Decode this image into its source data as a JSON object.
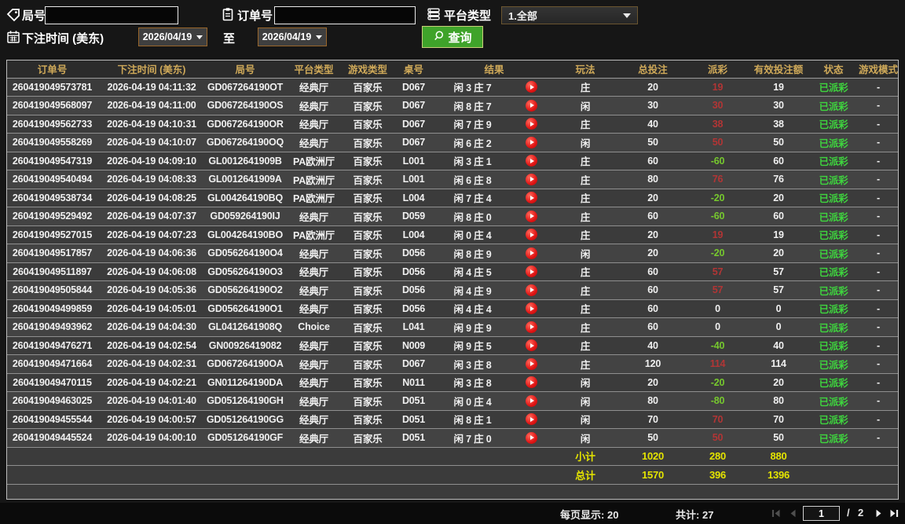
{
  "filters": {
    "round_label": "局号",
    "order_label": "订单号",
    "platform_label": "平台类型",
    "platform_value": "1.全部",
    "bet_time_label": "下注时间 (美东)",
    "date_from": "2026/04/19",
    "date_to": "2026/04/19",
    "to_label": "至",
    "search_label": "查询"
  },
  "icons": {
    "round": "tag-icon",
    "order": "clipboard-icon",
    "platform": "list-icon",
    "bet_time": "calendar-icon",
    "query": "search-icon",
    "result": "play-icon",
    "pagination": [
      "first-page-icon",
      "prev-page-icon",
      "next-page-icon",
      "last-page-icon"
    ]
  },
  "colors": {
    "header_text": "#cfa959",
    "payout_win": "#b23535",
    "payout_loss": "#76c82e",
    "status_paid": "#3ed43e",
    "summary_text": "#e4e400",
    "query_button": "#3fa32a",
    "date_border": "#99662b",
    "play_button": "#e01414"
  },
  "table": {
    "columns": [
      "订单号",
      "下注时间 (美东)",
      "局号",
      "平台类型",
      "游戏类型",
      "桌号",
      "结果",
      "玩法",
      "总投注",
      "派彩",
      "有效投注额",
      "状态",
      "游戏模式"
    ],
    "rows": [
      {
        "order": "260419049573781",
        "time": "2026-04-19 04:11:32",
        "round": "GD067264190OT",
        "platform": "经典厅",
        "game": "百家乐",
        "table": "D067",
        "result": "闲 3 庄 7",
        "bet_on": "庄",
        "total_bet": "20",
        "payout": "19",
        "valid_bet": "19",
        "status": "已派彩",
        "mode": "-"
      },
      {
        "order": "260419049568097",
        "time": "2026-04-19 04:11:00",
        "round": "GD067264190OS",
        "platform": "经典厅",
        "game": "百家乐",
        "table": "D067",
        "result": "闲 8 庄 7",
        "bet_on": "闲",
        "total_bet": "30",
        "payout": "30",
        "valid_bet": "30",
        "status": "已派彩",
        "mode": "-"
      },
      {
        "order": "260419049562733",
        "time": "2026-04-19 04:10:31",
        "round": "GD067264190OR",
        "platform": "经典厅",
        "game": "百家乐",
        "table": "D067",
        "result": "闲 7 庄 9",
        "bet_on": "庄",
        "total_bet": "40",
        "payout": "38",
        "valid_bet": "38",
        "status": "已派彩",
        "mode": "-"
      },
      {
        "order": "260419049558269",
        "time": "2026-04-19 04:10:07",
        "round": "GD067264190OQ",
        "platform": "经典厅",
        "game": "百家乐",
        "table": "D067",
        "result": "闲 6 庄 2",
        "bet_on": "闲",
        "total_bet": "50",
        "payout": "50",
        "valid_bet": "50",
        "status": "已派彩",
        "mode": "-"
      },
      {
        "order": "260419049547319",
        "time": "2026-04-19 04:09:10",
        "round": "GL0012641909B",
        "platform": "PA欧洲厅",
        "game": "百家乐",
        "table": "L001",
        "result": "闲 3 庄 1",
        "bet_on": "庄",
        "total_bet": "60",
        "payout": "-60",
        "valid_bet": "60",
        "status": "已派彩",
        "mode": "-"
      },
      {
        "order": "260419049540494",
        "time": "2026-04-19 04:08:33",
        "round": "GL0012641909A",
        "platform": "PA欧洲厅",
        "game": "百家乐",
        "table": "L001",
        "result": "闲 6 庄 8",
        "bet_on": "庄",
        "total_bet": "80",
        "payout": "76",
        "valid_bet": "76",
        "status": "已派彩",
        "mode": "-"
      },
      {
        "order": "260419049538734",
        "time": "2026-04-19 04:08:25",
        "round": "GL004264190BQ",
        "platform": "PA欧洲厅",
        "game": "百家乐",
        "table": "L004",
        "result": "闲 7 庄 4",
        "bet_on": "庄",
        "total_bet": "20",
        "payout": "-20",
        "valid_bet": "20",
        "status": "已派彩",
        "mode": "-"
      },
      {
        "order": "260419049529492",
        "time": "2026-04-19 04:07:37",
        "round": "GD059264190IJ",
        "platform": "经典厅",
        "game": "百家乐",
        "table": "D059",
        "result": "闲 8 庄 0",
        "bet_on": "庄",
        "total_bet": "60",
        "payout": "-60",
        "valid_bet": "60",
        "status": "已派彩",
        "mode": "-"
      },
      {
        "order": "260419049527015",
        "time": "2026-04-19 04:07:23",
        "round": "GL004264190BO",
        "platform": "PA欧洲厅",
        "game": "百家乐",
        "table": "L004",
        "result": "闲 0 庄 4",
        "bet_on": "庄",
        "total_bet": "20",
        "payout": "19",
        "valid_bet": "19",
        "status": "已派彩",
        "mode": "-"
      },
      {
        "order": "260419049517857",
        "time": "2026-04-19 04:06:36",
        "round": "GD056264190O4",
        "platform": "经典厅",
        "game": "百家乐",
        "table": "D056",
        "result": "闲 8 庄 9",
        "bet_on": "闲",
        "total_bet": "20",
        "payout": "-20",
        "valid_bet": "20",
        "status": "已派彩",
        "mode": "-"
      },
      {
        "order": "260419049511897",
        "time": "2026-04-19 04:06:08",
        "round": "GD056264190O3",
        "platform": "经典厅",
        "game": "百家乐",
        "table": "D056",
        "result": "闲 4 庄 5",
        "bet_on": "庄",
        "total_bet": "60",
        "payout": "57",
        "valid_bet": "57",
        "status": "已派彩",
        "mode": "-"
      },
      {
        "order": "260419049505844",
        "time": "2026-04-19 04:05:36",
        "round": "GD056264190O2",
        "platform": "经典厅",
        "game": "百家乐",
        "table": "D056",
        "result": "闲 4 庄 9",
        "bet_on": "庄",
        "total_bet": "60",
        "payout": "57",
        "valid_bet": "57",
        "status": "已派彩",
        "mode": "-"
      },
      {
        "order": "260419049499859",
        "time": "2026-04-19 04:05:01",
        "round": "GD056264190O1",
        "platform": "经典厅",
        "game": "百家乐",
        "table": "D056",
        "result": "闲 4 庄 4",
        "bet_on": "庄",
        "total_bet": "60",
        "payout": "0",
        "valid_bet": "0",
        "status": "已派彩",
        "mode": "-"
      },
      {
        "order": "260419049493962",
        "time": "2026-04-19 04:04:30",
        "round": "GL0412641908Q",
        "platform": "Choice",
        "game": "百家乐",
        "table": "L041",
        "result": "闲 9 庄 9",
        "bet_on": "庄",
        "total_bet": "60",
        "payout": "0",
        "valid_bet": "0",
        "status": "已派彩",
        "mode": "-"
      },
      {
        "order": "260419049476271",
        "time": "2026-04-19 04:02:54",
        "round": "GN00926419082",
        "platform": "经典厅",
        "game": "百家乐",
        "table": "N009",
        "result": "闲 9 庄 5",
        "bet_on": "庄",
        "total_bet": "40",
        "payout": "-40",
        "valid_bet": "40",
        "status": "已派彩",
        "mode": "-"
      },
      {
        "order": "260419049471664",
        "time": "2026-04-19 04:02:31",
        "round": "GD067264190OA",
        "platform": "经典厅",
        "game": "百家乐",
        "table": "D067",
        "result": "闲 3 庄 8",
        "bet_on": "庄",
        "total_bet": "120",
        "payout": "114",
        "valid_bet": "114",
        "status": "已派彩",
        "mode": "-"
      },
      {
        "order": "260419049470115",
        "time": "2026-04-19 04:02:21",
        "round": "GN011264190DA",
        "platform": "经典厅",
        "game": "百家乐",
        "table": "N011",
        "result": "闲 3 庄 8",
        "bet_on": "闲",
        "total_bet": "20",
        "payout": "-20",
        "valid_bet": "20",
        "status": "已派彩",
        "mode": "-"
      },
      {
        "order": "260419049463025",
        "time": "2026-04-19 04:01:40",
        "round": "GD051264190GH",
        "platform": "经典厅",
        "game": "百家乐",
        "table": "D051",
        "result": "闲 0 庄 4",
        "bet_on": "闲",
        "total_bet": "80",
        "payout": "-80",
        "valid_bet": "80",
        "status": "已派彩",
        "mode": "-"
      },
      {
        "order": "260419049455544",
        "time": "2026-04-19 04:00:57",
        "round": "GD051264190GG",
        "platform": "经典厅",
        "game": "百家乐",
        "table": "D051",
        "result": "闲 8 庄 1",
        "bet_on": "闲",
        "total_bet": "70",
        "payout": "70",
        "valid_bet": "70",
        "status": "已派彩",
        "mode": "-"
      },
      {
        "order": "260419049445524",
        "time": "2026-04-19 04:00:10",
        "round": "GD051264190GF",
        "platform": "经典厅",
        "game": "百家乐",
        "table": "D051",
        "result": "闲 7 庄 0",
        "bet_on": "闲",
        "total_bet": "50",
        "payout": "50",
        "valid_bet": "50",
        "status": "已派彩",
        "mode": "-"
      }
    ],
    "subtotal": {
      "label": "小计",
      "total_bet": "1020",
      "payout": "280",
      "valid_bet": "880"
    },
    "total": {
      "label": "总计",
      "total_bet": "1570",
      "payout": "396",
      "valid_bet": "1396"
    }
  },
  "footer": {
    "page_size_label": "每页显示:",
    "page_size": "20",
    "total_label": "共计:",
    "total_count": "27",
    "current_page": "1",
    "page_divider": "/",
    "total_pages": "2"
  }
}
